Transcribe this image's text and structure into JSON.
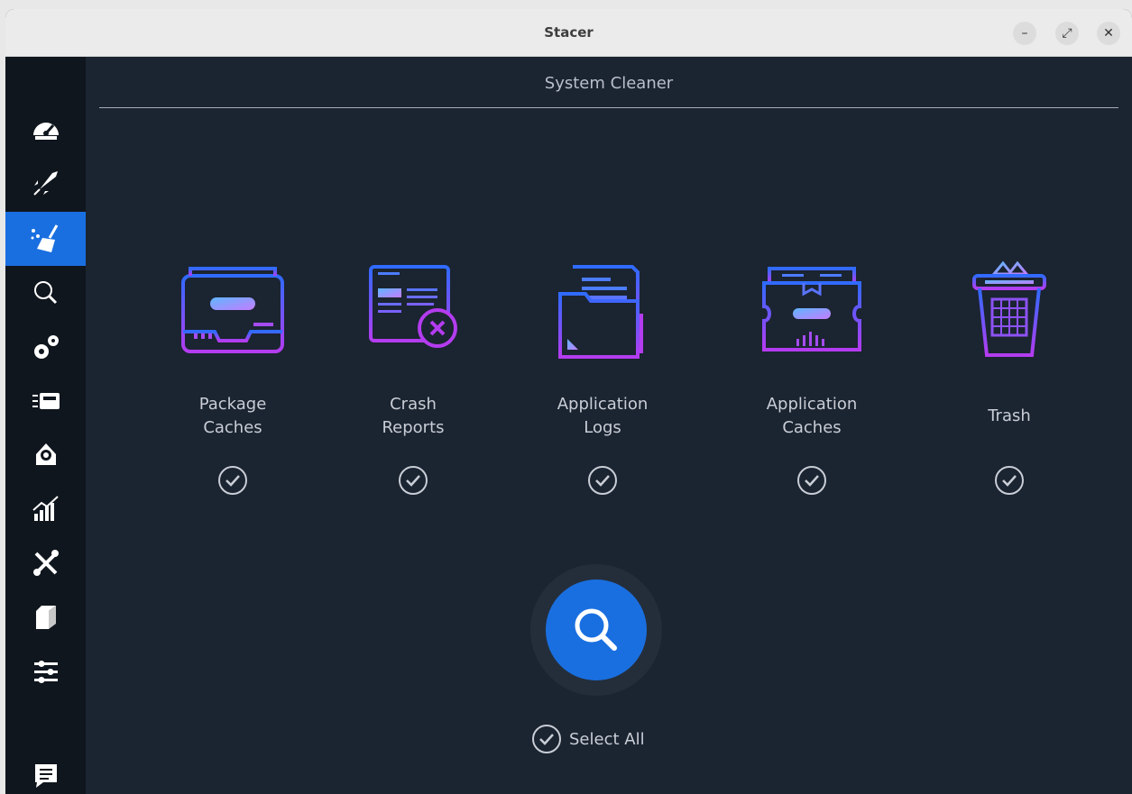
{
  "window": {
    "title": "Stacer",
    "minimize": "–",
    "maximize": "⤢",
    "close": "✕"
  },
  "sidebar": {
    "active_index": 2,
    "items": [
      {
        "icon": "dashboard-icon"
      },
      {
        "icon": "rocket-icon"
      },
      {
        "icon": "broom-icon"
      },
      {
        "icon": "search-icon"
      },
      {
        "icon": "gears-icon"
      },
      {
        "icon": "processes-icon"
      },
      {
        "icon": "uninstaller-icon"
      },
      {
        "icon": "resources-chart-icon"
      },
      {
        "icon": "tools-icon"
      },
      {
        "icon": "package-box-icon"
      },
      {
        "icon": "settings-sliders-icon"
      },
      {
        "icon": "feedback-icon"
      }
    ]
  },
  "main": {
    "title": "System Cleaner",
    "items": [
      {
        "label": "Package\nCaches",
        "icon": "package-caches-icon",
        "checked": true
      },
      {
        "label": "Crash\nReports",
        "icon": "crash-reports-icon",
        "checked": true
      },
      {
        "label": "Application\nLogs",
        "icon": "application-logs-icon",
        "checked": true
      },
      {
        "label": "Application\nCaches",
        "icon": "application-caches-icon",
        "checked": true
      },
      {
        "label": "Trash",
        "icon": "trash-icon",
        "checked": true
      }
    ],
    "scan_icon": "search-icon",
    "select_all": {
      "label": "Select All",
      "checked": true
    }
  },
  "colors": {
    "accent": "#1a6fe0",
    "background": "#1b2431",
    "sidebar": "#10161e",
    "gradient_start": "#2f6bff",
    "gradient_end": "#b43cf0"
  }
}
